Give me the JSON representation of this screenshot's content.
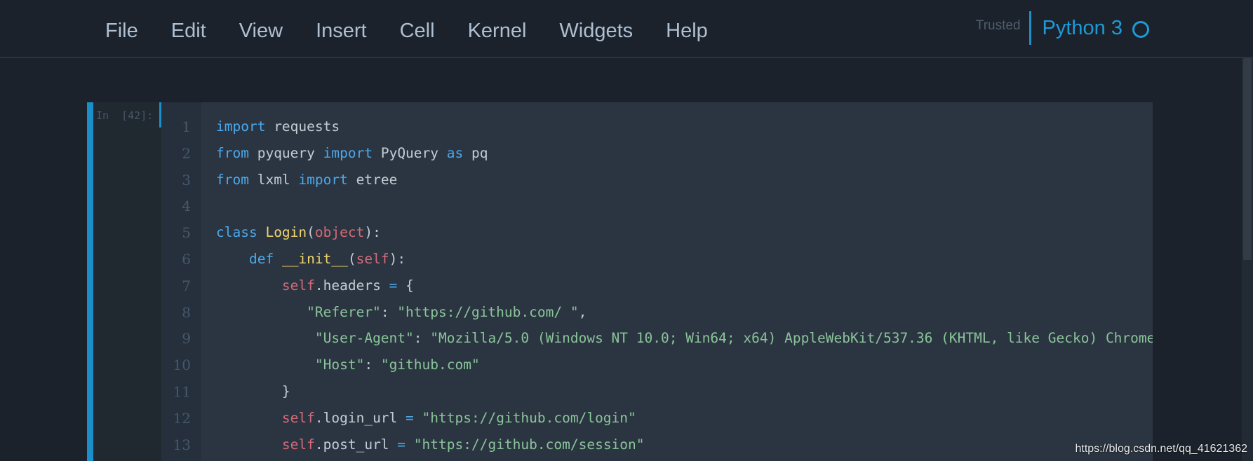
{
  "menubar": {
    "items": [
      "File",
      "Edit",
      "View",
      "Insert",
      "Cell",
      "Kernel",
      "Widgets",
      "Help"
    ],
    "trusted_label": "Trusted",
    "kernel_name": "Python 3",
    "kernel_status_icon": "circle-idle-icon"
  },
  "cell": {
    "prompt": "In  [42]:",
    "line_numbers": [
      "1",
      "2",
      "3",
      "4",
      "5",
      "6",
      "7",
      "8",
      "9",
      "10",
      "11",
      "12",
      "13"
    ],
    "lines": [
      [
        [
          "kw",
          "import"
        ],
        [
          "plain",
          " requests"
        ]
      ],
      [
        [
          "kw",
          "from"
        ],
        [
          "plain",
          " pyquery "
        ],
        [
          "kw",
          "import"
        ],
        [
          "plain",
          " PyQuery "
        ],
        [
          "kw",
          "as"
        ],
        [
          "plain",
          " pq"
        ]
      ],
      [
        [
          "kw",
          "from"
        ],
        [
          "plain",
          " lxml "
        ],
        [
          "kw",
          "import"
        ],
        [
          "plain",
          " etree"
        ]
      ],
      [],
      [
        [
          "kw",
          "class"
        ],
        [
          "plain",
          " "
        ],
        [
          "cls",
          "Login"
        ],
        [
          "plain",
          "("
        ],
        [
          "self",
          "object"
        ],
        [
          "plain",
          "):"
        ]
      ],
      [
        [
          "plain",
          "    "
        ],
        [
          "kw",
          "def"
        ],
        [
          "plain",
          " "
        ],
        [
          "cls",
          "__init__"
        ],
        [
          "plain",
          "("
        ],
        [
          "self",
          "self"
        ],
        [
          "plain",
          "):"
        ]
      ],
      [
        [
          "plain",
          "        "
        ],
        [
          "self",
          "self"
        ],
        [
          "plain",
          ".headers "
        ],
        [
          "op",
          "="
        ],
        [
          "plain",
          " {"
        ]
      ],
      [
        [
          "plain",
          "           "
        ],
        [
          "str",
          "\"Referer\""
        ],
        [
          "plain",
          ": "
        ],
        [
          "str",
          "\"https://github.com/ \""
        ],
        [
          "plain",
          ","
        ]
      ],
      [
        [
          "plain",
          "            "
        ],
        [
          "str",
          "\"User-Agent\""
        ],
        [
          "plain",
          ": "
        ],
        [
          "str",
          "\"Mozilla/5.0 (Windows NT 10.0; Win64; x64) AppleWebKit/537.36 (KHTML, like Gecko) Chrome"
        ]
      ],
      [
        [
          "plain",
          "            "
        ],
        [
          "str",
          "\"Host\""
        ],
        [
          "plain",
          ": "
        ],
        [
          "str",
          "\"github.com\""
        ]
      ],
      [
        [
          "plain",
          "        }"
        ]
      ],
      [
        [
          "plain",
          "        "
        ],
        [
          "self",
          "self"
        ],
        [
          "plain",
          ".login_url "
        ],
        [
          "op",
          "="
        ],
        [
          "plain",
          " "
        ],
        [
          "str",
          "\"https://github.com/login\""
        ]
      ],
      [
        [
          "plain",
          "        "
        ],
        [
          "self",
          "self"
        ],
        [
          "plain",
          ".post_url "
        ],
        [
          "op",
          "="
        ],
        [
          "plain",
          " "
        ],
        [
          "str",
          "\"https://github.com/session\""
        ]
      ]
    ]
  },
  "watermark": "https://blog.csdn.net/qq_41621362",
  "colors": {
    "background": "#1b222b",
    "accent": "#1a8fca",
    "keyword": "#4ba8ec",
    "class_name": "#f2d46b",
    "self": "#d56a77",
    "string": "#8ac49a"
  }
}
